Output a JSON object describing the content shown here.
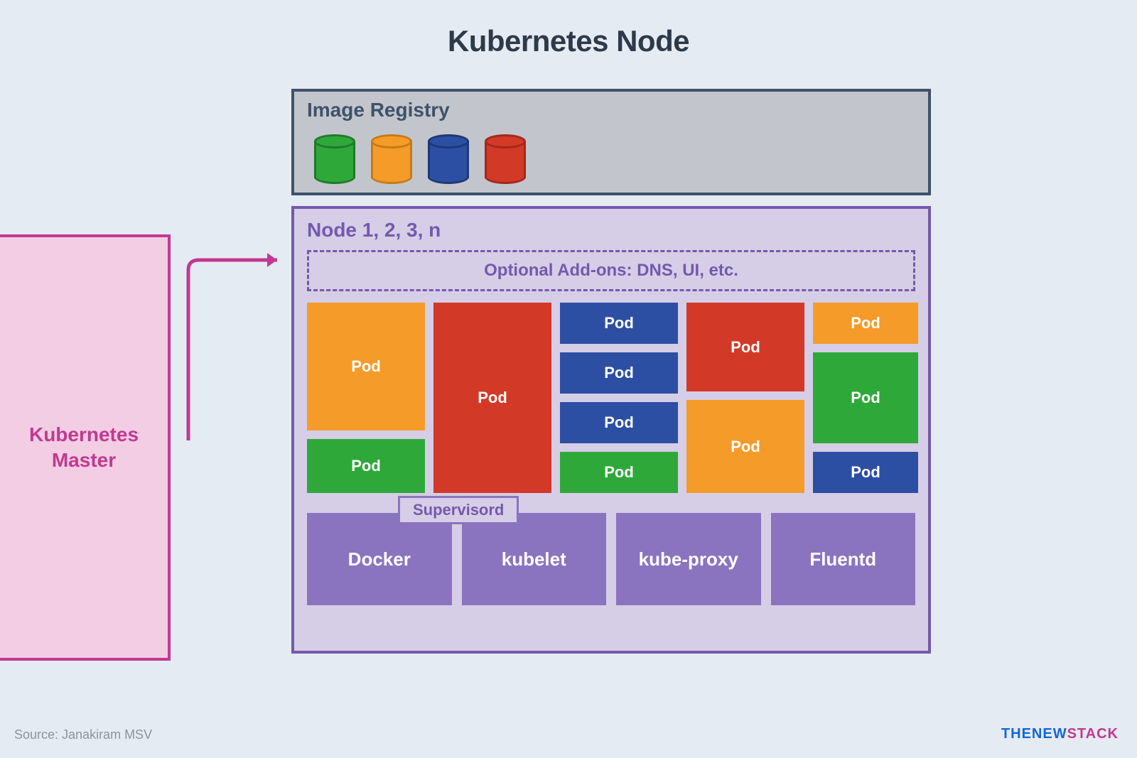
{
  "title": "Kubernetes Node",
  "registry": {
    "title": "Image Registry",
    "images": [
      {
        "color": "green"
      },
      {
        "color": "orange"
      },
      {
        "color": "blue"
      },
      {
        "color": "red"
      }
    ]
  },
  "master": {
    "label": "Kubernetes\nMaster"
  },
  "node": {
    "title": "Node 1, 2, 3, n",
    "addons_label": "Optional Add-ons: DNS, UI, etc.",
    "supervisord_label": "Supervisord",
    "pods": {
      "col1_top": "Pod",
      "col1_bot": "Pod",
      "col2": "Pod",
      "col3_1": "Pod",
      "col3_2": "Pod",
      "col3_3": "Pod",
      "col3_4": "Pod",
      "col4_top": "Pod",
      "col4_bot": "Pod",
      "col5_1": "Pod",
      "col5_2": "Pod",
      "col5_3": "Pod"
    },
    "services": {
      "docker": "Docker",
      "kubelet": "kubelet",
      "kubeproxy": "kube-proxy",
      "fluentd": "Fluentd"
    }
  },
  "source": "Source: Janakiram MSV",
  "brand": {
    "part1": "THENEW",
    "part2": "STACK"
  }
}
